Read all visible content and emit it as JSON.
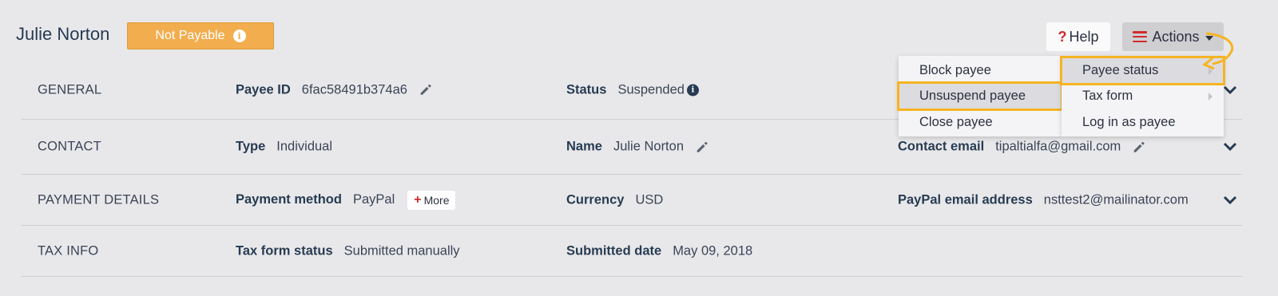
{
  "header": {
    "payee_name": "Julie Norton",
    "status_badge": "Not Payable",
    "help_label": "Help",
    "actions_label": "Actions"
  },
  "sections": [
    {
      "title": "GENERAL",
      "fields": [
        {
          "label": "Payee ID",
          "value": "6fac58491b374a6"
        },
        {
          "label": "Status",
          "value": "Suspended"
        }
      ]
    },
    {
      "title": "CONTACT",
      "fields": [
        {
          "label": "Type",
          "value": "Individual"
        },
        {
          "label": "Name",
          "value": "Julie Norton"
        },
        {
          "label": "Contact email",
          "value": "tipaltialfa@gmail.com"
        }
      ]
    },
    {
      "title": "PAYMENT DETAILS",
      "fields": [
        {
          "label": "Payment method",
          "value": "PayPal"
        },
        {
          "label": "Currency",
          "value": "USD"
        },
        {
          "label": "PayPal email address",
          "value": "nsttest2@mailinator.com"
        }
      ],
      "more_label": "More"
    },
    {
      "title": "TAX INFO",
      "fields": [
        {
          "label": "Tax form status",
          "value": "Submitted manually"
        },
        {
          "label": "Submitted date",
          "value": "May 09, 2018"
        }
      ]
    }
  ],
  "actions_menu": {
    "items": [
      "Payee status",
      "Tax form",
      "Log in as payee"
    ],
    "submenu": [
      "Block payee",
      "Unsuspend payee",
      "Close payee"
    ],
    "highlighted_item": "Payee status",
    "highlighted_subitem": "Unsuspend payee"
  },
  "colors": {
    "badge": "#f2ad4e",
    "highlight": "#f6b422",
    "accent_red": "#d12b2b"
  }
}
